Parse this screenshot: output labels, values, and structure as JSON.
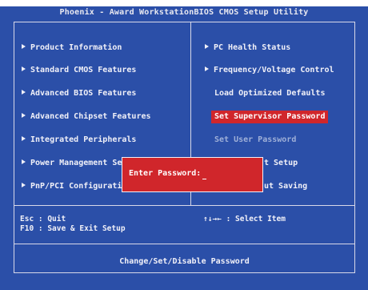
{
  "title": "Phoenix - Award WorkstationBIOS CMOS Setup Utility",
  "left_menu": [
    {
      "label": "Product Information",
      "arrow": true
    },
    {
      "label": "Standard CMOS Features",
      "arrow": true
    },
    {
      "label": "Advanced BIOS Features",
      "arrow": true
    },
    {
      "label": "Advanced Chipset Features",
      "arrow": true
    },
    {
      "label": "Integrated Peripherals",
      "arrow": true
    },
    {
      "label": "Power Management Se",
      "arrow": true
    },
    {
      "label": "PnP/PCI Configurati",
      "arrow": true
    }
  ],
  "right_menu": [
    {
      "label": "PC Health Status",
      "arrow": true
    },
    {
      "label": "Frequency/Voltage Control",
      "arrow": true
    },
    {
      "label": "Load Optimized Defaults",
      "arrow": false
    },
    {
      "label": "Set Supervisor Password",
      "arrow": false,
      "selected": true
    },
    {
      "label": "Set User Password",
      "arrow": false,
      "dim": true
    },
    {
      "label": "t Setup",
      "arrow": false
    },
    {
      "label": "ut Saving",
      "arrow": false
    }
  ],
  "popup": {
    "label": "Enter Password:"
  },
  "help": {
    "esc": "Esc : Quit",
    "f10": "F10 : Save & Exit Setup",
    "select": "↑↓→←   : Select Item"
  },
  "status_text": "Change/Set/Disable Password",
  "colors": {
    "background": "#2b4fa8",
    "highlight": "#d0262b",
    "text": "#f0f0f8"
  }
}
